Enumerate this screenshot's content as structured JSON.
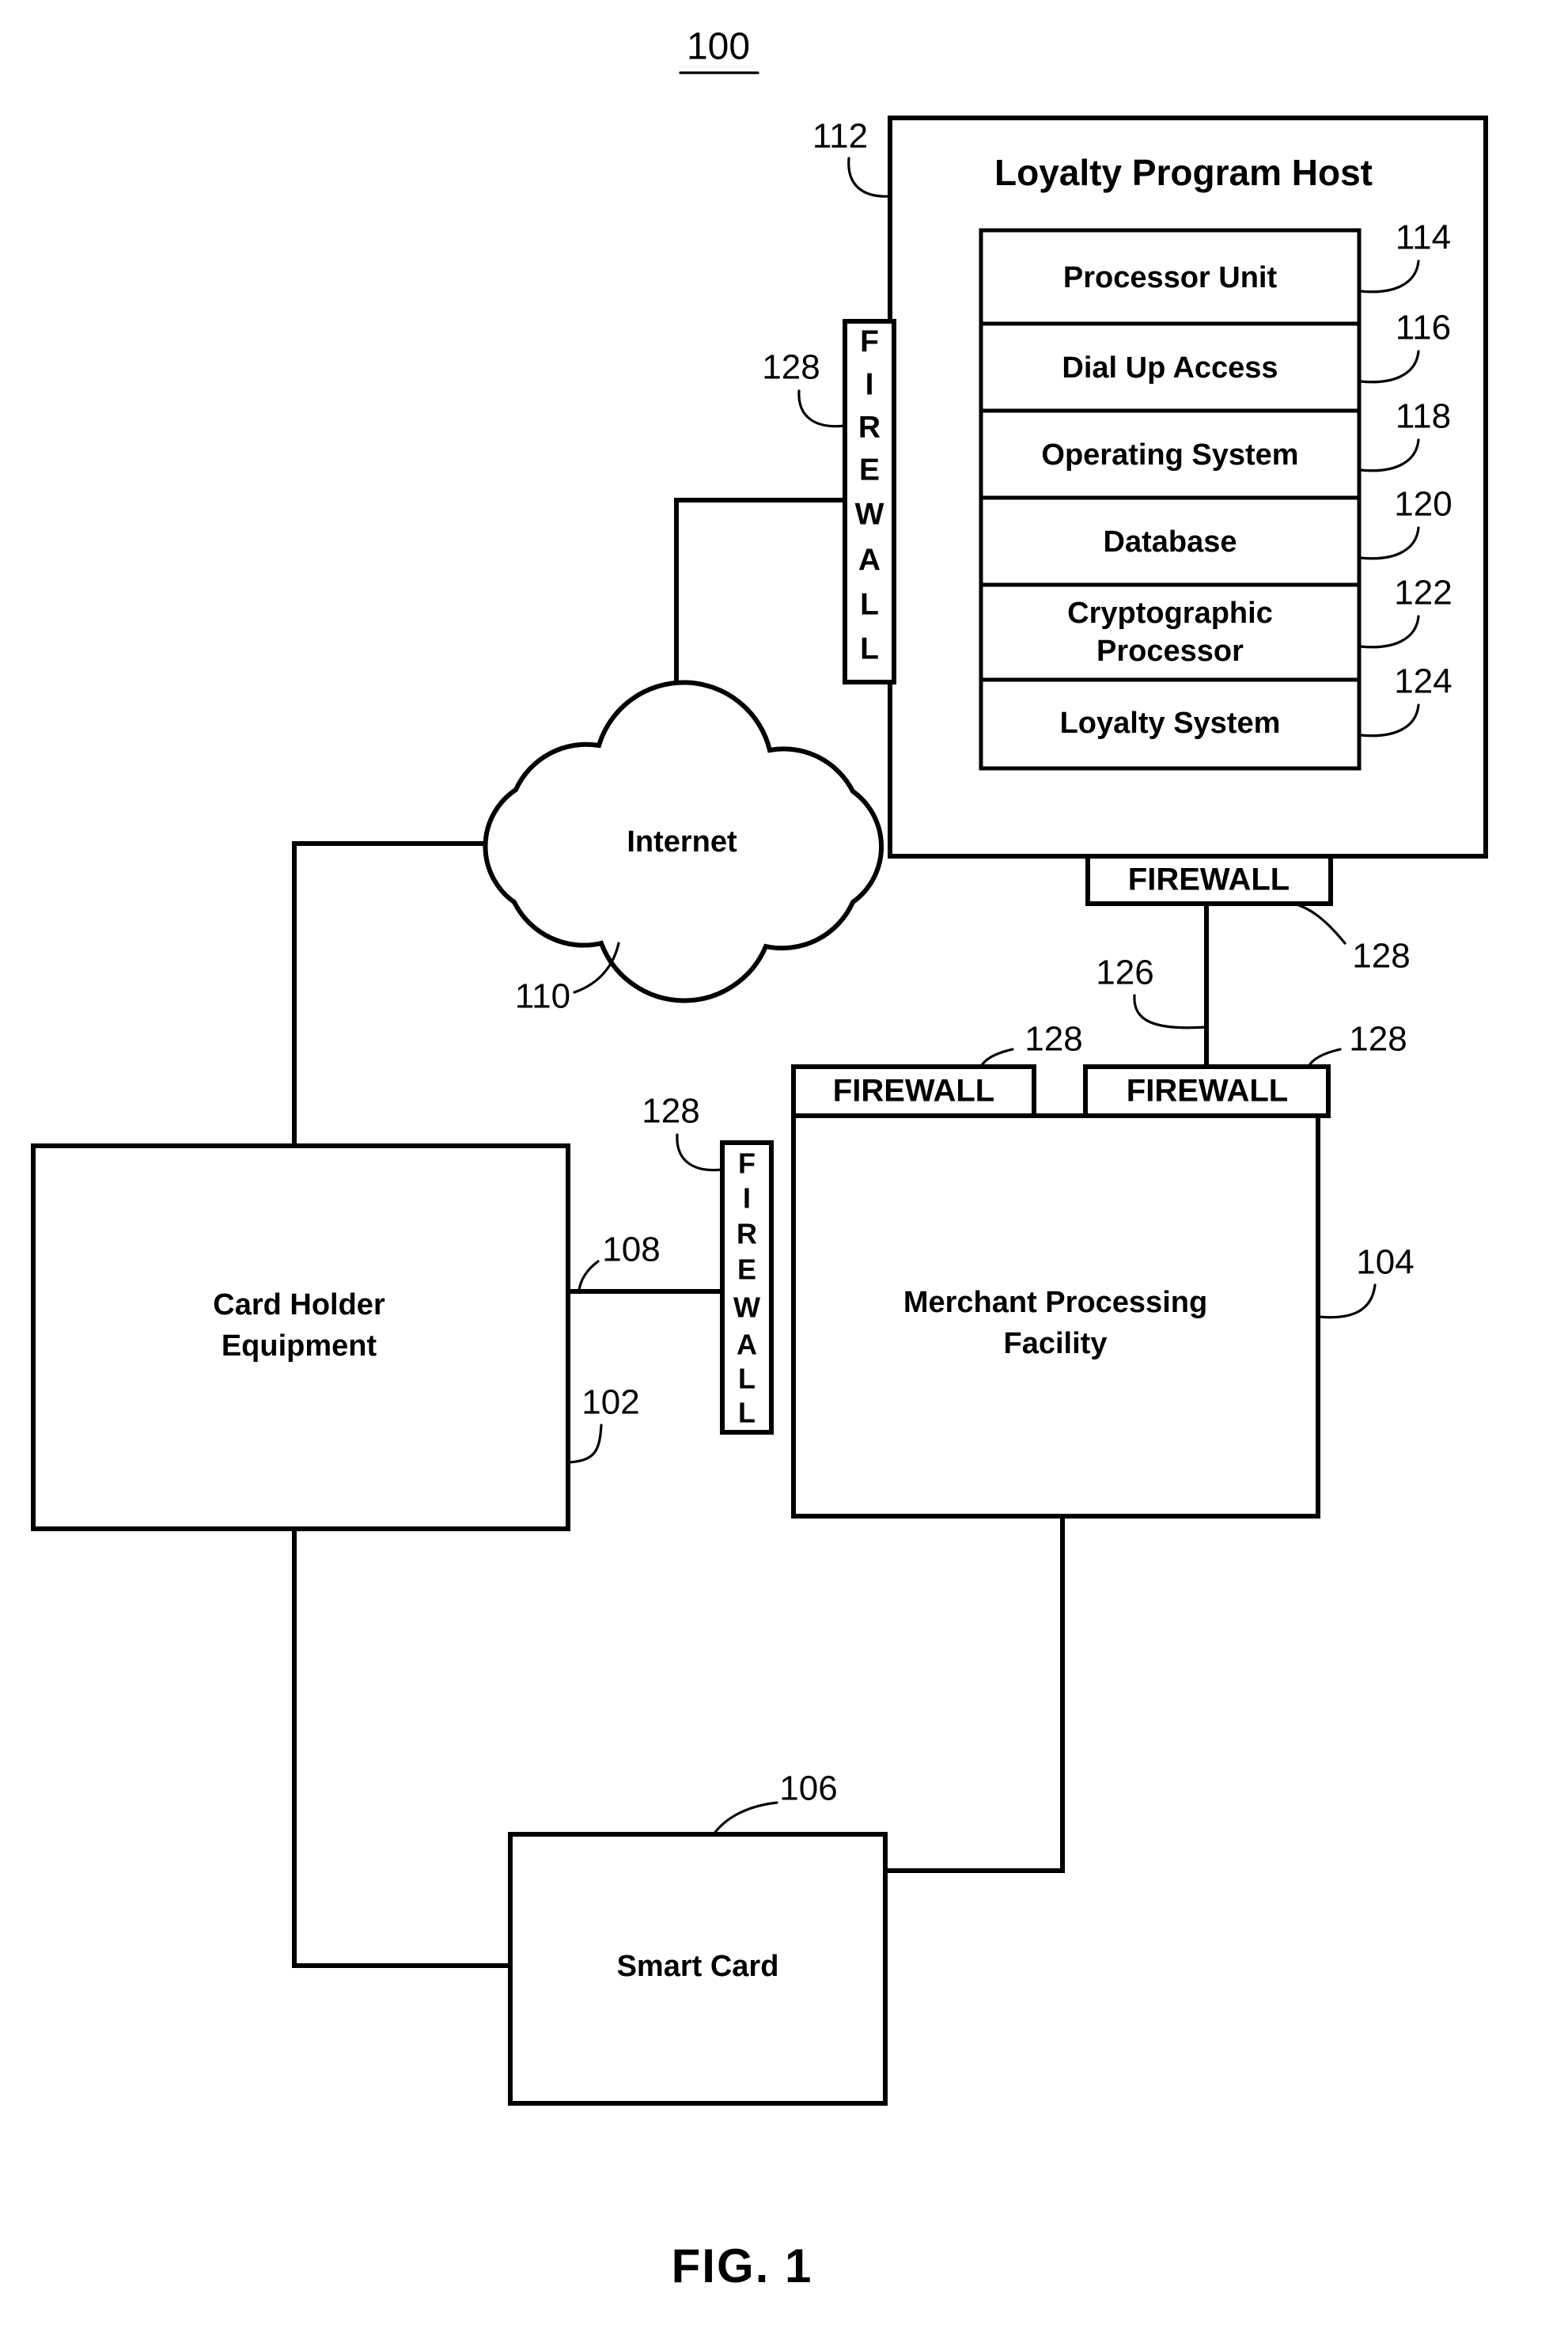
{
  "figure": {
    "figure_number_top": "100",
    "figure_caption": "FIG. 1"
  },
  "nodes": {
    "loyalty_program_host": {
      "title": "Loyalty Program Host",
      "ref": "112",
      "components": [
        {
          "label": "Processor Unit",
          "ref": "114"
        },
        {
          "label": "Dial Up Access",
          "ref": "116"
        },
        {
          "label": "Operating System",
          "ref": "118"
        },
        {
          "label": "Database",
          "ref": "120"
        },
        {
          "label": "Cryptographic Processor",
          "ref": "122",
          "line1": "Cryptographic",
          "line2": "Processor"
        },
        {
          "label": "Loyalty System",
          "ref": "124"
        }
      ]
    },
    "internet": {
      "label": "Internet",
      "ref": "110"
    },
    "card_holder_equipment": {
      "line1": "Card Holder",
      "line2": "Equipment",
      "ref": "102",
      "ref_link": "108"
    },
    "merchant_processing_facility": {
      "line1": "Merchant Processing",
      "line2": "Facility",
      "ref": "104"
    },
    "smart_card": {
      "label": "Smart Card",
      "ref": "106"
    }
  },
  "firewalls": {
    "label_horizontal": "FIREWALL",
    "label_vertical_letters": [
      "F",
      "I",
      "R",
      "E",
      "W",
      "A",
      "L",
      "L"
    ],
    "ref": "128",
    "items": [
      {
        "id": "host-left-vertical",
        "orientation": "vertical",
        "ref": "128"
      },
      {
        "id": "host-bottom-horizontal",
        "orientation": "horizontal",
        "ref": "128"
      },
      {
        "id": "merchant-top-left-horizontal",
        "orientation": "horizontal",
        "ref": "128"
      },
      {
        "id": "merchant-top-right-horizontal",
        "orientation": "horizontal",
        "ref": "128"
      },
      {
        "id": "merchant-left-vertical",
        "orientation": "vertical",
        "ref": "128"
      }
    ]
  },
  "links": {
    "host_to_merchant": "126",
    "cardholder_to_merchant": "108"
  },
  "colors": {
    "line": "#000000",
    "fill": "#ffffff",
    "text": "#000000"
  }
}
